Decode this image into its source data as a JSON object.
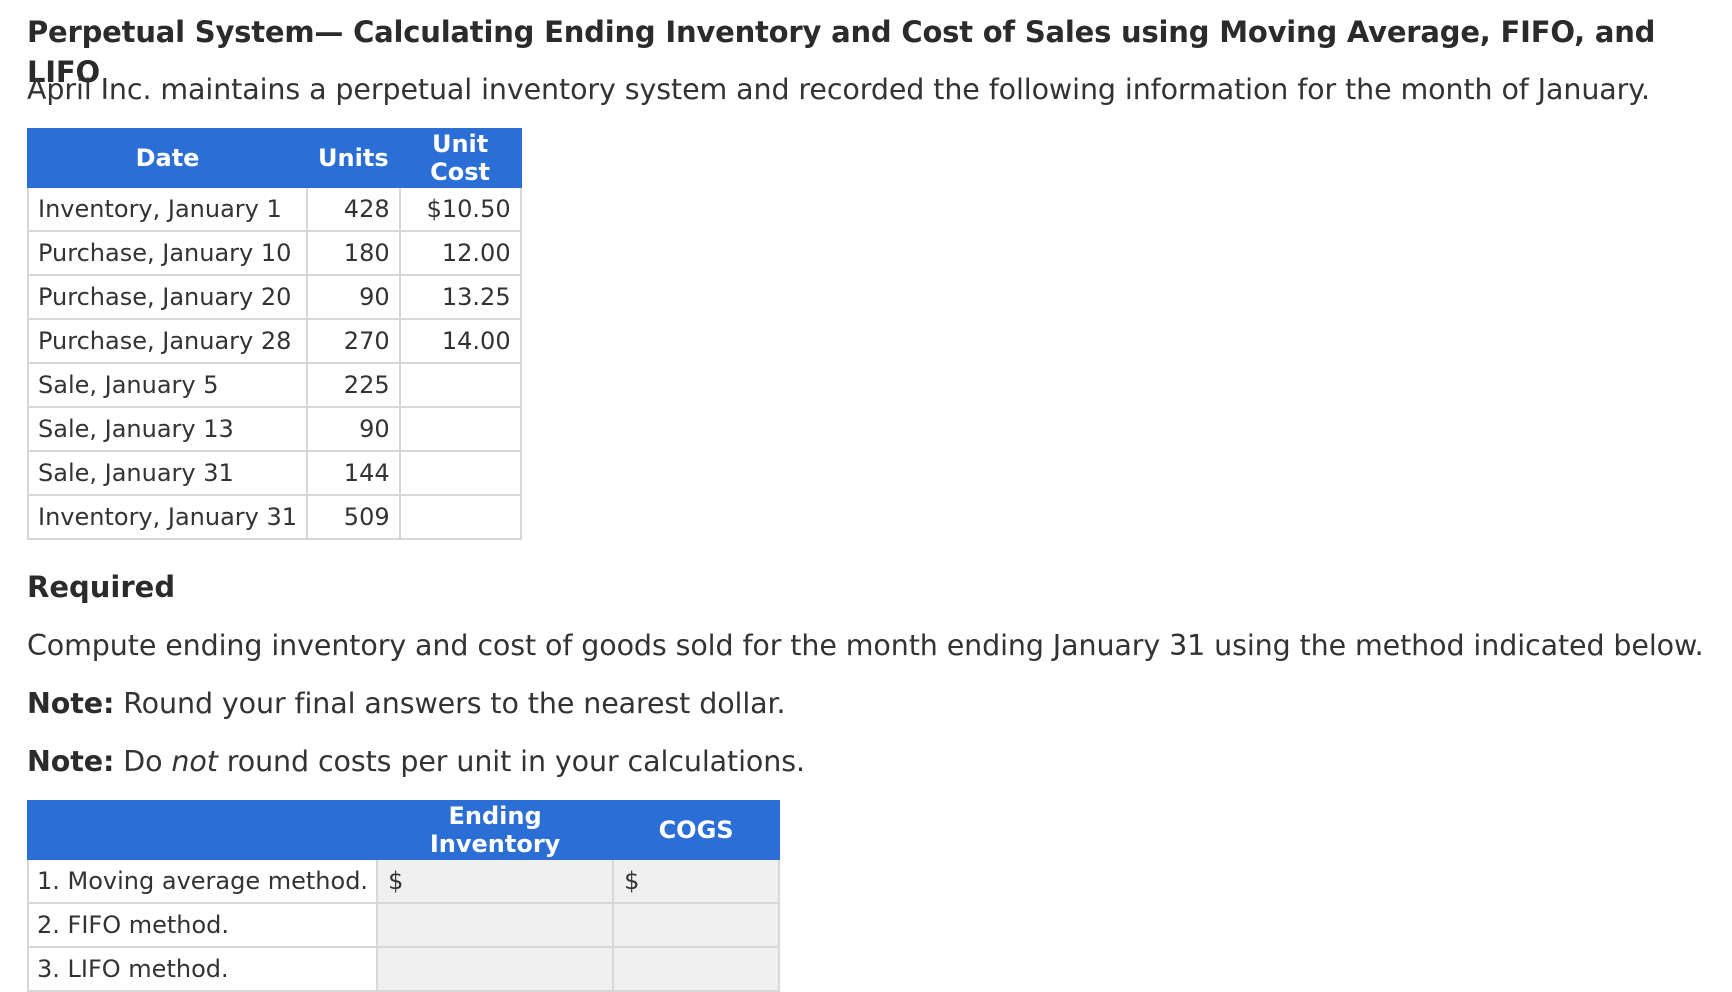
{
  "title": "Perpetual System— Calculating Ending Inventory and Cost of Sales using Moving Average, FIFO, and LIFO",
  "intro": "April Inc. maintains a perpetual inventory system and recorded the following information for the month of January.",
  "data_table": {
    "headers": [
      "Date",
      "Units",
      "Unit Cost"
    ],
    "rows": [
      [
        "Inventory, January 1",
        "428",
        "$10.50"
      ],
      [
        "Purchase, January 10",
        "180",
        "12.00"
      ],
      [
        "Purchase, January 20",
        "90",
        "13.25"
      ],
      [
        "Purchase, January 28",
        "270",
        "14.00"
      ],
      [
        "Sale, January 5",
        "225",
        ""
      ],
      [
        "Sale, January 13",
        "90",
        ""
      ],
      [
        "Sale, January 31",
        "144",
        ""
      ],
      [
        "Inventory, January 31",
        "509",
        ""
      ]
    ]
  },
  "required": {
    "heading": "Required",
    "instruction": "Compute ending inventory and cost of goods sold for the month ending January 31 using the method indicated below.",
    "note1_label": "Note:",
    "note1_text": " Round your final answers to the nearest dollar.",
    "note2_label": "Note:",
    "note2_pre": " Do ",
    "note2_em": "not",
    "note2_post": " round costs per unit in your calculations."
  },
  "answer_table": {
    "headers": [
      "",
      "Ending Inventory",
      "COGS"
    ],
    "rows": [
      {
        "label": "1. Moving average method.",
        "ending_prefix": "$",
        "cogs_prefix": "$",
        "ending_value": "",
        "cogs_value": ""
      },
      {
        "label": "2. FIFO method.",
        "ending_prefix": "",
        "cogs_prefix": "",
        "ending_value": "",
        "cogs_value": ""
      },
      {
        "label": "3. LIFO method.",
        "ending_prefix": "",
        "cogs_prefix": "",
        "ending_value": "",
        "cogs_value": ""
      }
    ]
  },
  "colors": {
    "header_blue": "#2b6fd6",
    "input_gray": "#f0f0f0",
    "border_gray": "#d7d7d7"
  }
}
